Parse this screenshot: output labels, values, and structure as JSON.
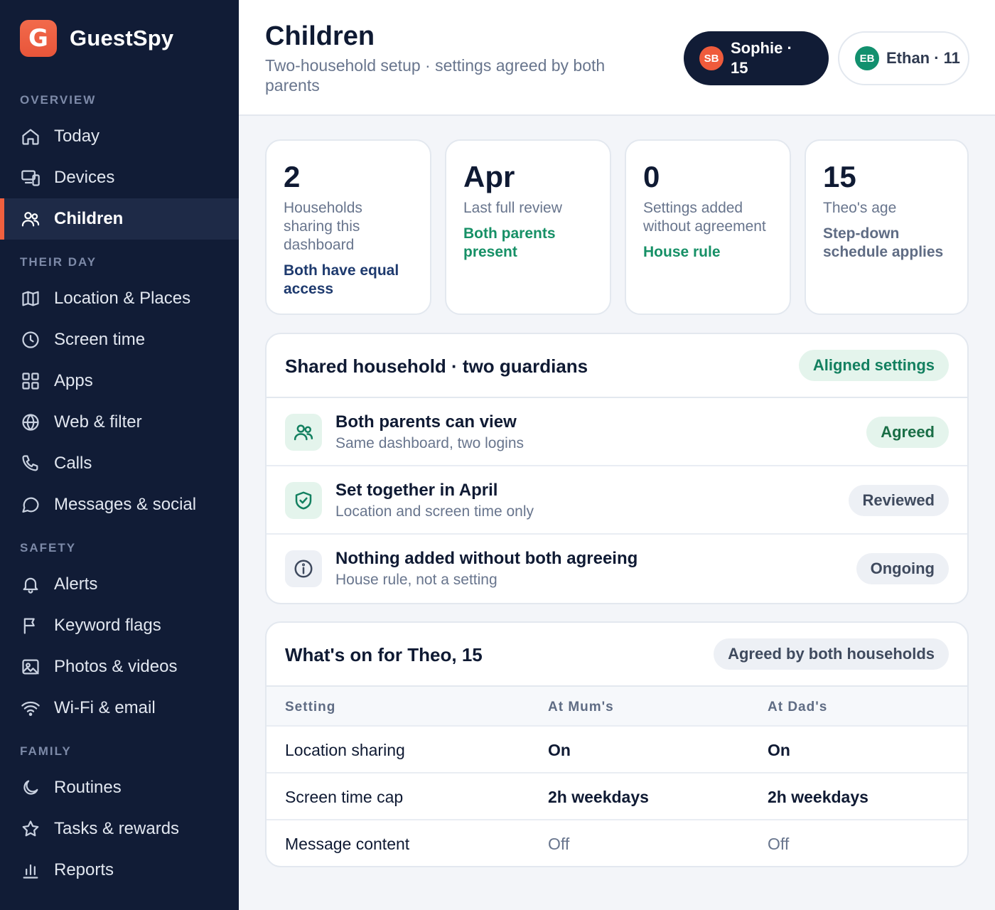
{
  "app": {
    "logo_letter": "G",
    "name": "GuestSpy"
  },
  "sidebar": {
    "sections": [
      {
        "label": "OVERVIEW",
        "items": [
          {
            "label": "Today",
            "icon": "home-icon"
          },
          {
            "label": "Devices",
            "icon": "devices-icon"
          },
          {
            "label": "Children",
            "icon": "users-icon",
            "active": true
          }
        ]
      },
      {
        "label": "THEIR DAY",
        "items": [
          {
            "label": "Location & Places",
            "icon": "map-icon"
          },
          {
            "label": "Screen time",
            "icon": "clock-icon"
          },
          {
            "label": "Apps",
            "icon": "grid-icon"
          },
          {
            "label": "Web & filter",
            "icon": "globe-icon"
          },
          {
            "label": "Calls",
            "icon": "phone-icon"
          },
          {
            "label": "Messages & social",
            "icon": "message-icon"
          }
        ]
      },
      {
        "label": "SAFETY",
        "items": [
          {
            "label": "Alerts",
            "icon": "bell-icon"
          },
          {
            "label": "Keyword flags",
            "icon": "flag-icon"
          },
          {
            "label": "Photos & videos",
            "icon": "image-icon"
          },
          {
            "label": "Wi-Fi & email",
            "icon": "wifi-icon"
          }
        ]
      },
      {
        "label": "FAMILY",
        "items": [
          {
            "label": "Routines",
            "icon": "moon-icon"
          },
          {
            "label": "Tasks & rewards",
            "icon": "star-icon"
          },
          {
            "label": "Reports",
            "icon": "bar-chart-icon"
          }
        ]
      }
    ]
  },
  "header": {
    "title": "Children",
    "subtitle": "Two-household setup · settings agreed by both parents",
    "children": [
      {
        "initials": "SB",
        "label": "Sophie · 15",
        "selected": true
      },
      {
        "initials": "EB",
        "label": "Ethan · 11",
        "selected": false
      }
    ]
  },
  "stats": [
    {
      "value": "2",
      "label": "Households sharing this dashboard",
      "note": "Both have equal access"
    },
    {
      "value": "Apr",
      "label": "Last full review",
      "note": "Both parents present"
    },
    {
      "value": "0",
      "label": "Settings added without agreement",
      "note": "House rule"
    },
    {
      "value": "15",
      "label": "Theo's age",
      "note": "Step-down schedule applies"
    }
  ],
  "household": {
    "title": "Shared household · two guardians",
    "badge": "Aligned settings",
    "rows": [
      {
        "title": "Both parents can view",
        "sub": "Same dashboard, two logins",
        "status": "Agreed",
        "icon": "users-icon"
      },
      {
        "title": "Set together in April",
        "sub": "Location and screen time only",
        "status": "Reviewed",
        "icon": "shield-check-icon"
      },
      {
        "title": "Nothing added without both agreeing",
        "sub": "House rule, not a setting",
        "status": "Ongoing",
        "icon": "info-icon"
      }
    ]
  },
  "settings": {
    "title": "What's on for Theo, 15",
    "badge": "Agreed by both households",
    "columns": [
      "Setting",
      "At Mum's",
      "At Dad's"
    ],
    "rows": [
      [
        "Location sharing",
        "On",
        "On"
      ],
      [
        "Screen time cap",
        "2h weekdays",
        "2h weekdays"
      ],
      [
        "Message content",
        "Off",
        "Off"
      ]
    ]
  }
}
